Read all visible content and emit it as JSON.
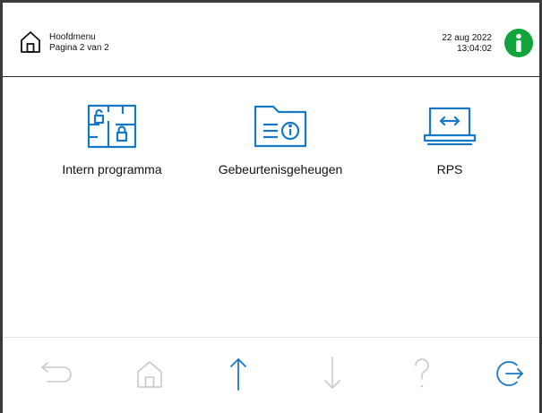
{
  "header": {
    "title": "Hoofdmenu",
    "subtitle": "Pagina 2 van 2",
    "date": "22 aug 2022",
    "time": "13:04:02",
    "home_icon": "home-icon",
    "info_icon": "info-icon"
  },
  "tiles": [
    {
      "label": "Intern programma",
      "icon": "floorplan-lock-icon"
    },
    {
      "label": "Gebeurtenisgeheugen",
      "icon": "folder-info-icon"
    },
    {
      "label": "RPS",
      "icon": "laptop-transfer-icon"
    }
  ],
  "footer": {
    "buttons": [
      {
        "name": "back",
        "icon": "back-arrow-icon",
        "enabled": false
      },
      {
        "name": "home",
        "icon": "home-icon",
        "enabled": false
      },
      {
        "name": "up",
        "icon": "arrow-up-icon",
        "enabled": true
      },
      {
        "name": "down",
        "icon": "arrow-down-icon",
        "enabled": false
      },
      {
        "name": "help",
        "icon": "question-icon",
        "enabled": false
      },
      {
        "name": "logout",
        "icon": "logout-icon",
        "enabled": true
      }
    ]
  },
  "colors": {
    "accent": "#1778c8",
    "info_green": "#12a33a",
    "disabled": "#c9c9c9",
    "text": "#111111"
  }
}
